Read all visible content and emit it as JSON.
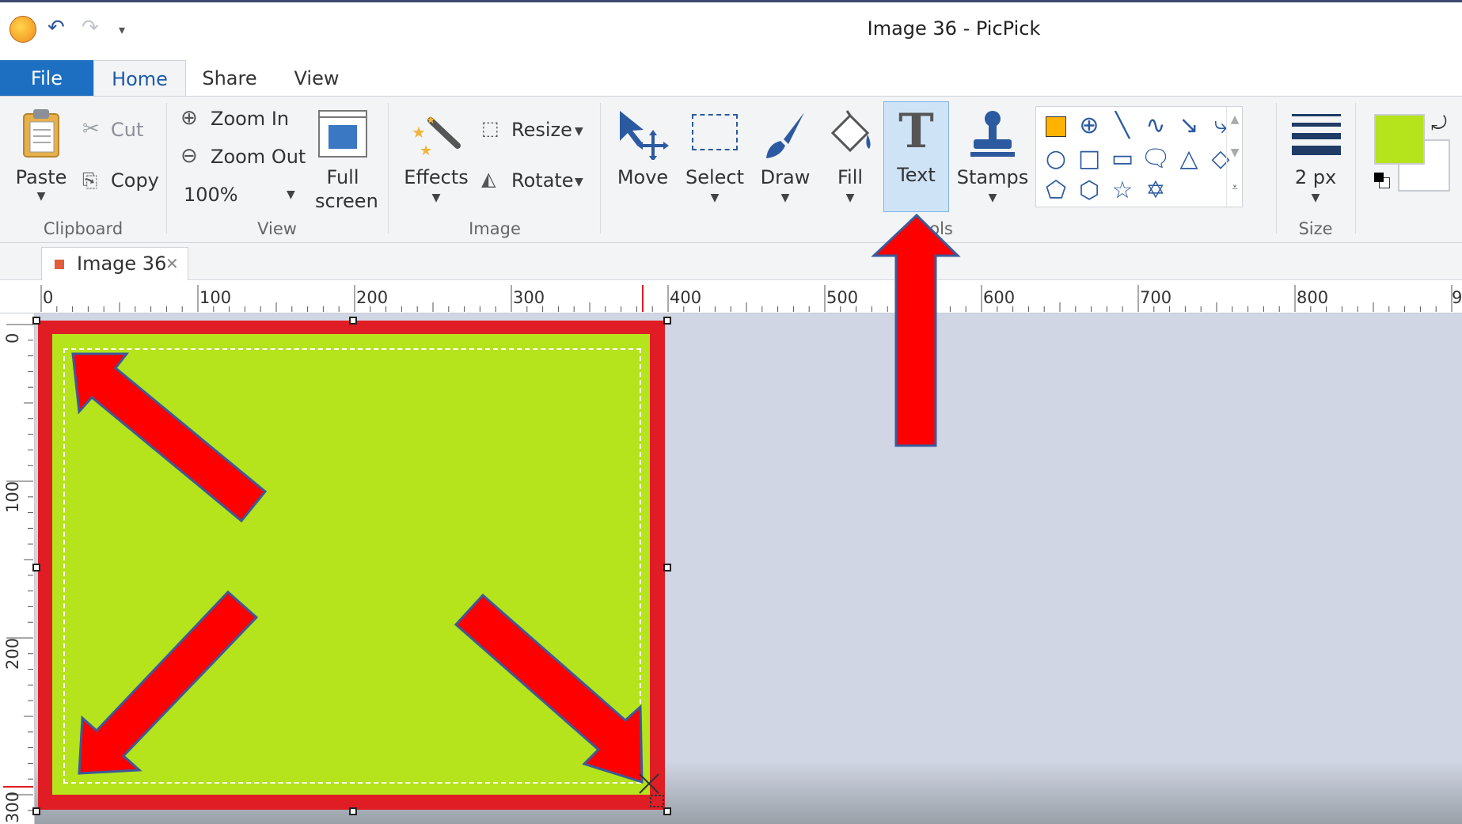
{
  "window": {
    "title": "Image 36 - PicPick"
  },
  "quick_access": {
    "undo_icon": "undo-icon",
    "redo_icon": "redo-icon",
    "customize_icon": "customize-icon",
    "app_icon": "app-logo-icon"
  },
  "tabs": [
    {
      "label": "File"
    },
    {
      "label": "Home"
    },
    {
      "label": "Share"
    },
    {
      "label": "View"
    }
  ],
  "ribbon": {
    "clipboard": {
      "paste": "Paste",
      "cut": "Cut",
      "copy": "Copy",
      "group": "Clipboard"
    },
    "view": {
      "zoom_in": "Zoom In",
      "zoom_out": "Zoom Out",
      "zoom_value": "100%",
      "full": "Full",
      "screen": "screen",
      "group": "View"
    },
    "image": {
      "effects": "Effects",
      "resize": "Resize",
      "rotate": "Rotate",
      "group": "Image"
    },
    "tools": {
      "move": "Move",
      "select": "Select",
      "draw": "Draw",
      "fill": "Fill",
      "text": "Text",
      "stamps": "Stamps",
      "group": "Tools"
    },
    "size": {
      "value": "2 px",
      "group": "Size"
    },
    "colors": {
      "foreground": "#b5e31c",
      "background": "#ffffff"
    }
  },
  "document_tab": {
    "label": "Image 36",
    "close": "✕"
  },
  "rulers": {
    "horizontal": [
      "0",
      "100",
      "200",
      "300",
      "400",
      "500",
      "600",
      "700",
      "800",
      "9"
    ],
    "vertical": [
      "0",
      "100",
      "200",
      "300"
    ]
  },
  "canvas": {
    "image_border_color": "#e01d25",
    "image_fill_color": "#b5e31c",
    "arrow_color": "#ff0000",
    "workspace_color": "#d1d6e4"
  }
}
